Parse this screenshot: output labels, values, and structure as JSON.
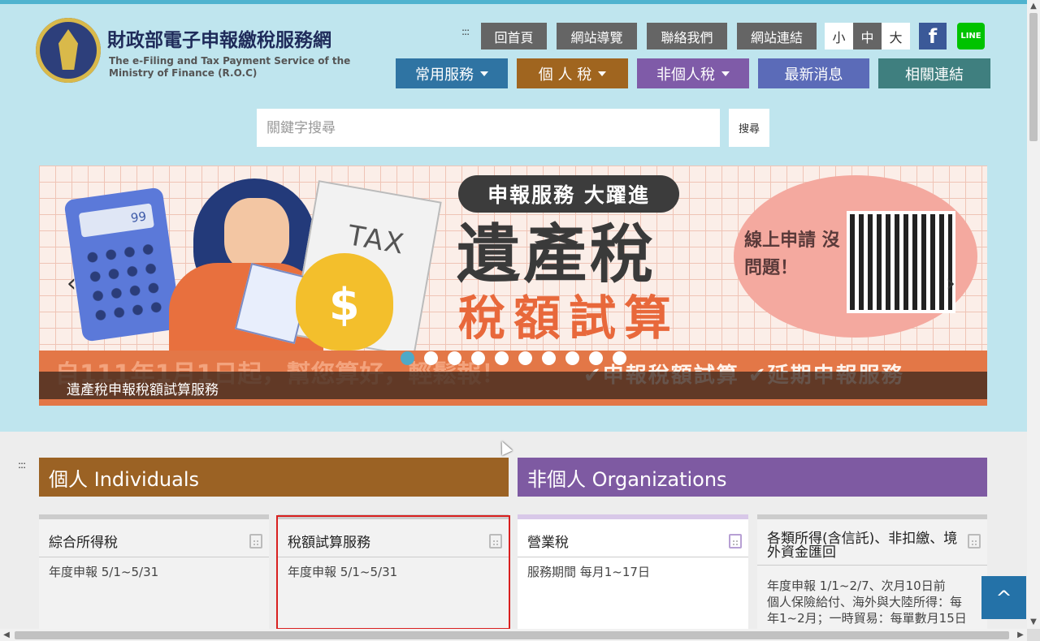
{
  "site": {
    "title": "財政部電子申報繳稅服務網",
    "subtitle_line1": "The e-Filing and Tax Payment Service of the",
    "subtitle_line2": "Ministry of Finance (R.O.C)"
  },
  "accesskey_marker": ":::",
  "topnav": [
    "回首頁",
    "網站導覽",
    "聯絡我們",
    "網站連結"
  ],
  "fontsize": {
    "small": "小",
    "medium": "中",
    "large": "大"
  },
  "social": {
    "facebook": "f",
    "line": "LINE",
    "facebook_color": "#3b5998",
    "line_color": "#00c300"
  },
  "mainnav": [
    {
      "label": "常用服務",
      "color": "#2f74a3",
      "dropdown": true
    },
    {
      "label": "個 人 稅",
      "color": "#a0651f",
      "dropdown": true
    },
    {
      "label": "非個人稅",
      "color": "#7f5ba8",
      "dropdown": true
    },
    {
      "label": "最新消息",
      "color": "#5b6bb8",
      "dropdown": false
    },
    {
      "label": "相關連結",
      "color": "#3f7f7f",
      "dropdown": false
    }
  ],
  "search": {
    "placeholder": "關鍵字搜尋",
    "button": "搜尋"
  },
  "banner": {
    "pill": "申報服務 大躍進",
    "headline": "遺產稅",
    "subheadline": "稅額試算",
    "bubble": "線上申請 沒問題！",
    "calc_display": "99",
    "doc_label": "TAX",
    "money_sign": "$",
    "strip_left": "自111年1月1日起，幫您算好，輕鬆報！",
    "strip_right": "✔申報稅額試算 ✔延期申報服務",
    "caption": "遺產稅申報稅額試算服務",
    "slide_count": 10,
    "active_slide": 1,
    "prev_arrow": "‹",
    "next_arrow": "›"
  },
  "sections": {
    "individuals": {
      "label": "個人 Individuals",
      "color": "#9b6224"
    },
    "organizations": {
      "label": "非個人 Organizations",
      "color": "#7e5aa2"
    }
  },
  "cards": [
    {
      "title": "綜合所得稅",
      "body": "年度申報 5/1~5/31",
      "accent": "#cccccc"
    },
    {
      "title": "稅額試算服務",
      "body": "年度申報 5/1~5/31",
      "accent": "#cccccc"
    },
    {
      "title": "營業稅",
      "body": "服務期間 每月1~17日",
      "accent": "#d8c8e8"
    },
    {
      "title": "各類所得(含信託)、非扣繳、境外資金匯回",
      "body_lines": [
        "年度申報 1/1~2/7、次月10日前",
        "個人保險給付、海外與大陸所得：每",
        "年1~2月；一時貿易：每單數月15日"
      ],
      "accent": "#cccccc"
    }
  ],
  "back_to_top": "^"
}
